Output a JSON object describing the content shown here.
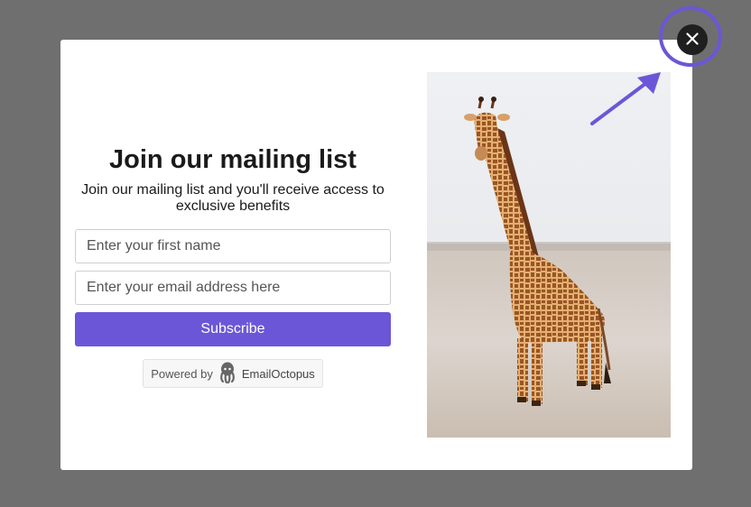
{
  "popup": {
    "title": "Join our mailing list",
    "subtitle": "Join our mailing list and you'll receive access to exclusive benefits",
    "first_name_placeholder": "Enter your first name",
    "email_placeholder": "Enter your email address here",
    "subscribe_label": "Subscribe",
    "powered_by_label": "Powered by",
    "powered_by_brand": "EmailOctopus"
  },
  "colors": {
    "accent": "#6c56d8",
    "overlay": "#6f6f6f",
    "close_button": "#1f1f1f"
  },
  "icons": {
    "close": "close-icon",
    "brand": "octopus-icon",
    "annotation": "arrow-icon"
  }
}
